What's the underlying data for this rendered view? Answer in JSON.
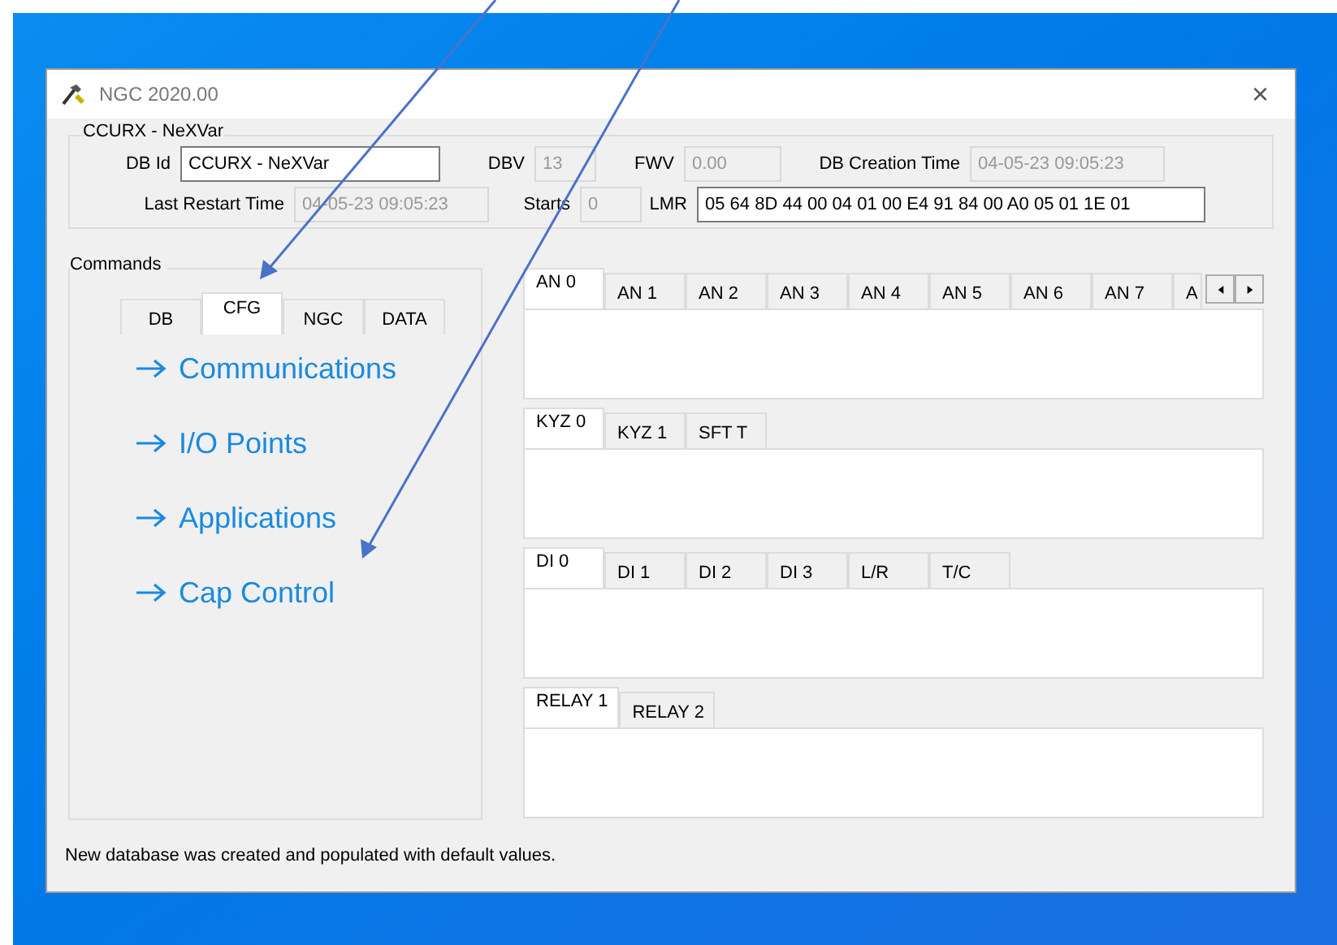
{
  "window": {
    "title": "NGC 2020.00",
    "close": "×"
  },
  "db_group": {
    "title": "CCURX - NeXVar",
    "rows": [
      [
        {
          "label": "DB Id",
          "value": "CCURX - NeXVar",
          "disabled": false
        },
        {
          "label": "DBV",
          "value": "13",
          "disabled": true
        },
        {
          "label": "FWV",
          "value": "0.00",
          "disabled": true
        },
        {
          "label": "DB Creation Time",
          "value": "04-05-23 09:05:23",
          "disabled": true
        }
      ],
      [
        {
          "label": "Last Restart Time",
          "value": "04-05-23 09:05:23",
          "disabled": true
        },
        {
          "label": "Starts",
          "value": "0",
          "disabled": true
        },
        {
          "label": "LMR",
          "value": "05 64 8D 44 00 04 01 00 E4 91 84 00 A0 05 01 1E 01",
          "disabled": false
        }
      ]
    ]
  },
  "commands": {
    "title": "Commands",
    "tabs": [
      {
        "label": "DB",
        "selected": false
      },
      {
        "label": "CFG",
        "selected": true
      },
      {
        "label": "NGC",
        "selected": false
      },
      {
        "label": "DATA",
        "selected": false
      }
    ],
    "links": [
      "Communications",
      "I/O Points",
      "Applications",
      "Cap Control"
    ]
  },
  "tab_panels": [
    {
      "scroll_buttons": true,
      "tabs": [
        {
          "label": "AN 0",
          "selected": true
        },
        {
          "label": "AN 1",
          "selected": false
        },
        {
          "label": "AN 2",
          "selected": false
        },
        {
          "label": "AN 3",
          "selected": false
        },
        {
          "label": "AN 4",
          "selected": false
        },
        {
          "label": "AN 5",
          "selected": false
        },
        {
          "label": "AN 6",
          "selected": false
        },
        {
          "label": "AN 7",
          "selected": false
        },
        {
          "label": "A",
          "selected": false
        }
      ]
    },
    {
      "tabs": [
        {
          "label": "KYZ 0",
          "selected": true
        },
        {
          "label": "KYZ 1",
          "selected": false
        },
        {
          "label": "SFT T",
          "selected": false
        }
      ]
    },
    {
      "tabs": [
        {
          "label": "DI 0",
          "selected": true
        },
        {
          "label": "DI 1",
          "selected": false
        },
        {
          "label": "DI 2",
          "selected": false
        },
        {
          "label": "DI 3",
          "selected": false
        },
        {
          "label": "L/R",
          "selected": false
        },
        {
          "label": "T/C",
          "selected": false
        }
      ]
    },
    {
      "tabs": [
        {
          "label": "RELAY 1",
          "selected": true
        },
        {
          "label": "RELAY 2",
          "selected": false
        }
      ]
    }
  ],
  "status_bar": "New database was created and populated with default values."
}
